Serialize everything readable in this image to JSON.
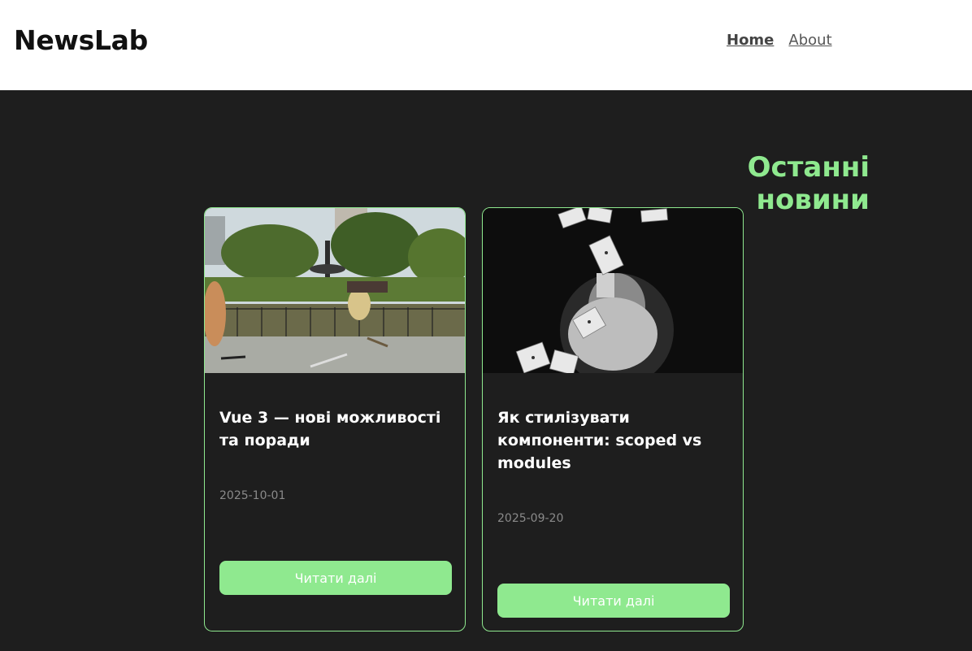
{
  "header": {
    "brand": "NewsLab",
    "nav": [
      {
        "label": "Home",
        "active": true
      },
      {
        "label": "About",
        "active": false
      }
    ]
  },
  "main": {
    "section_title": "Останні новини",
    "cards": [
      {
        "image_desc": "park-skateboard-photo",
        "title": "Vue 3 — нові можливості та поради",
        "date": "2025-10-01",
        "button": "Читати далі"
      },
      {
        "image_desc": "playing-cards-bw-photo",
        "title": "Як стилізувати компоненти: scoped vs modules",
        "date": "2025-09-20",
        "button": "Читати далі"
      }
    ]
  },
  "colors": {
    "accent": "#8fe98f",
    "background": "#1e1e1e",
    "header_bg": "#ffffff"
  }
}
